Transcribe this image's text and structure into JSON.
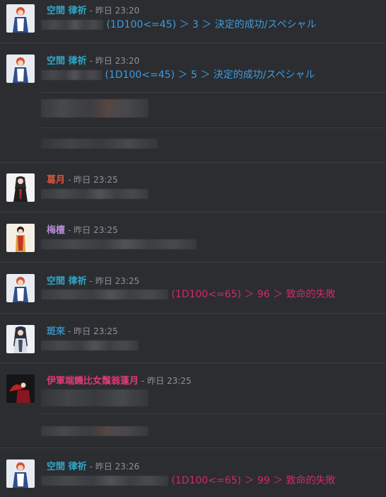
{
  "colors": {
    "background": "#2b2d31",
    "name_kuukan": "#31a8c9",
    "name_kuzuki": "#e0563a",
    "name_baisei": "#b48ad8",
    "name_hanrai": "#3a8fbf",
    "name_igun": "#e03a74",
    "success_text": "#3e9bdf",
    "fail_text": "#d02a6a",
    "timestamp": "#8e9297"
  },
  "messages": [
    {
      "avatar_icon": "character-avatar-redhair-icon",
      "username": "空間 律祈",
      "timestamp": "- 昨日 23:20",
      "roll": "(1D100<=45) ＞ 3 ＞ 決定的成功/スペシャル"
    },
    {
      "avatar_icon": "character-avatar-redhair-icon",
      "username": "空間 律祈",
      "timestamp": "- 昨日 23:20",
      "roll": "(1D100<=45) ＞ 5 ＞ 決定的成功/スペシャル"
    },
    {
      "avatar_icon": "character-avatar-darkhair-icon",
      "username": "葛月",
      "timestamp": "- 昨日 23:25"
    },
    {
      "avatar_icon": "character-avatar-kimono-icon",
      "username": "梅檀",
      "timestamp": "- 昨日 23:25"
    },
    {
      "avatar_icon": "character-avatar-redhair-icon",
      "username": "空間 律祈",
      "timestamp": "- 昨日 23:25",
      "roll": "(1D100<=65) ＞ 96 ＞ 致命的失敗"
    },
    {
      "avatar_icon": "character-avatar-longhair-icon",
      "username": "斑來",
      "timestamp": "- 昨日 23:25"
    },
    {
      "avatar_icon": "character-avatar-redfan-icon",
      "username": "伊軍端饑比女鬚翁蓬月",
      "timestamp": "- 昨日 23:25"
    },
    {
      "avatar_icon": "character-avatar-redhair-icon",
      "username": "空間 律祈",
      "timestamp": "- 昨日 23:26",
      "roll": "(1D100<=65) ＞ 99 ＞ 致命的失敗"
    }
  ]
}
